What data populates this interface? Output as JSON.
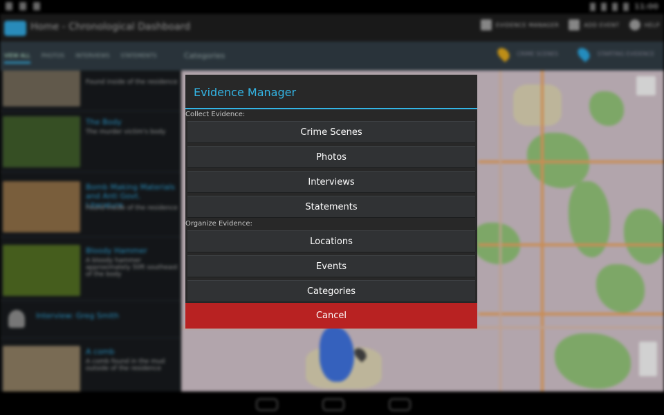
{
  "status_bar": {
    "time": "11:00"
  },
  "action_bar": {
    "title": "Home - Chronological Dashboard",
    "actions": [
      {
        "label": "EVIDENCE MANAGER",
        "icon": "pencil-icon"
      },
      {
        "label": "ADD EVENT",
        "icon": "plus-icon"
      },
      {
        "label": "HELP",
        "icon": "help-icon"
      }
    ]
  },
  "tabs": {
    "items": [
      "VIEW ALL",
      "PHOTOS",
      "INTERVIEWS",
      "STATEMENTS"
    ],
    "selected": "VIEW ALL",
    "categories_label": "Categories",
    "right_items": [
      {
        "label": "CRIME SCENES",
        "color": "#d9a21b"
      },
      {
        "label": "STARTING EVIDENCE",
        "color": "#2aa0d8"
      }
    ]
  },
  "evidence_list": [
    {
      "title": "",
      "description": "Found inside of the residence"
    },
    {
      "title": "The Body",
      "description": "The murder victim's body"
    },
    {
      "title": "Bomb Making Materials and Anti Govt. Literature",
      "description": "Found inside of the residence"
    },
    {
      "title": "Bloody Hammer",
      "description": "A bloody hammer approximately 50ft southeast of the body"
    },
    {
      "title": "Interview: Greg Smith",
      "description": ""
    },
    {
      "title": "A comb",
      "description": "A comb found in the mud outside of the residence"
    }
  ],
  "dialog": {
    "title": "Evidence Manager",
    "collect_label": "Collect Evidence:",
    "collect_buttons": [
      "Crime Scenes",
      "Photos",
      "Interviews",
      "Statements"
    ],
    "organize_label": "Organize Evidence:",
    "organize_buttons": [
      "Locations",
      "Events",
      "Categories"
    ],
    "cancel_label": "Cancel",
    "accent_color": "#33b5e5",
    "cancel_color": "#b82222"
  }
}
